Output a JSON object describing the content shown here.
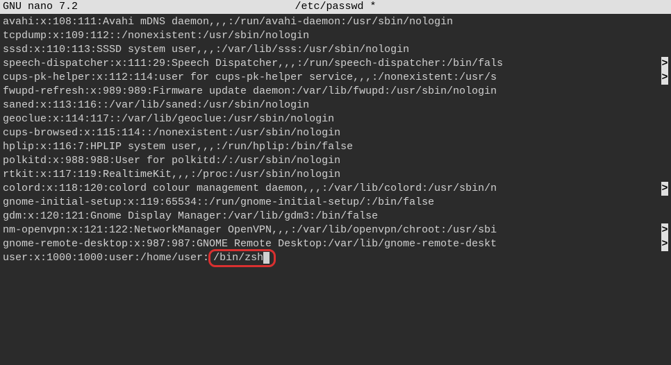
{
  "titlebar": {
    "app": "  GNU nano 7.2",
    "filename": "/etc/passwd *"
  },
  "lines": [
    {
      "text": "avahi:x:108:111:Avahi mDNS daemon,,,:/run/avahi-daemon:/usr/sbin/nologin",
      "cont": false
    },
    {
      "text": "tcpdump:x:109:112::/nonexistent:/usr/sbin/nologin",
      "cont": false
    },
    {
      "text": "sssd:x:110:113:SSSD system user,,,:/var/lib/sss:/usr/sbin/nologin",
      "cont": false
    },
    {
      "text": "speech-dispatcher:x:111:29:Speech Dispatcher,,,:/run/speech-dispatcher:/bin/fals",
      "cont": true
    },
    {
      "text": "cups-pk-helper:x:112:114:user for cups-pk-helper service,,,:/nonexistent:/usr/s",
      "cont": true
    },
    {
      "text": "fwupd-refresh:x:989:989:Firmware update daemon:/var/lib/fwupd:/usr/sbin/nologin",
      "cont": false
    },
    {
      "text": "saned:x:113:116::/var/lib/saned:/usr/sbin/nologin",
      "cont": false
    },
    {
      "text": "geoclue:x:114:117::/var/lib/geoclue:/usr/sbin/nologin",
      "cont": false
    },
    {
      "text": "cups-browsed:x:115:114::/nonexistent:/usr/sbin/nologin",
      "cont": false
    },
    {
      "text": "hplip:x:116:7:HPLIP system user,,,:/run/hplip:/bin/false",
      "cont": false
    },
    {
      "text": "polkitd:x:988:988:User for polkitd:/:/usr/sbin/nologin",
      "cont": false
    },
    {
      "text": "rtkit:x:117:119:RealtimeKit,,,:/proc:/usr/sbin/nologin",
      "cont": false
    },
    {
      "text": "colord:x:118:120:colord colour management daemon,,,:/var/lib/colord:/usr/sbin/n",
      "cont": true
    },
    {
      "text": "gnome-initial-setup:x:119:65534::/run/gnome-initial-setup/:/bin/false",
      "cont": false
    },
    {
      "text": "gdm:x:120:121:Gnome Display Manager:/var/lib/gdm3:/bin/false",
      "cont": false
    },
    {
      "text": "nm-openvpn:x:121:122:NetworkManager OpenVPN,,,:/var/lib/openvpn/chroot:/usr/sbi",
      "cont": true
    },
    {
      "text": "gnome-remote-desktop:x:987:987:GNOME Remote Desktop:/var/lib/gnome-remote-deskt",
      "cont": true
    }
  ],
  "lastline": {
    "prefix": "user:x:1000:1000:user:/home/user:",
    "highlighted": "/bin/zsh"
  }
}
